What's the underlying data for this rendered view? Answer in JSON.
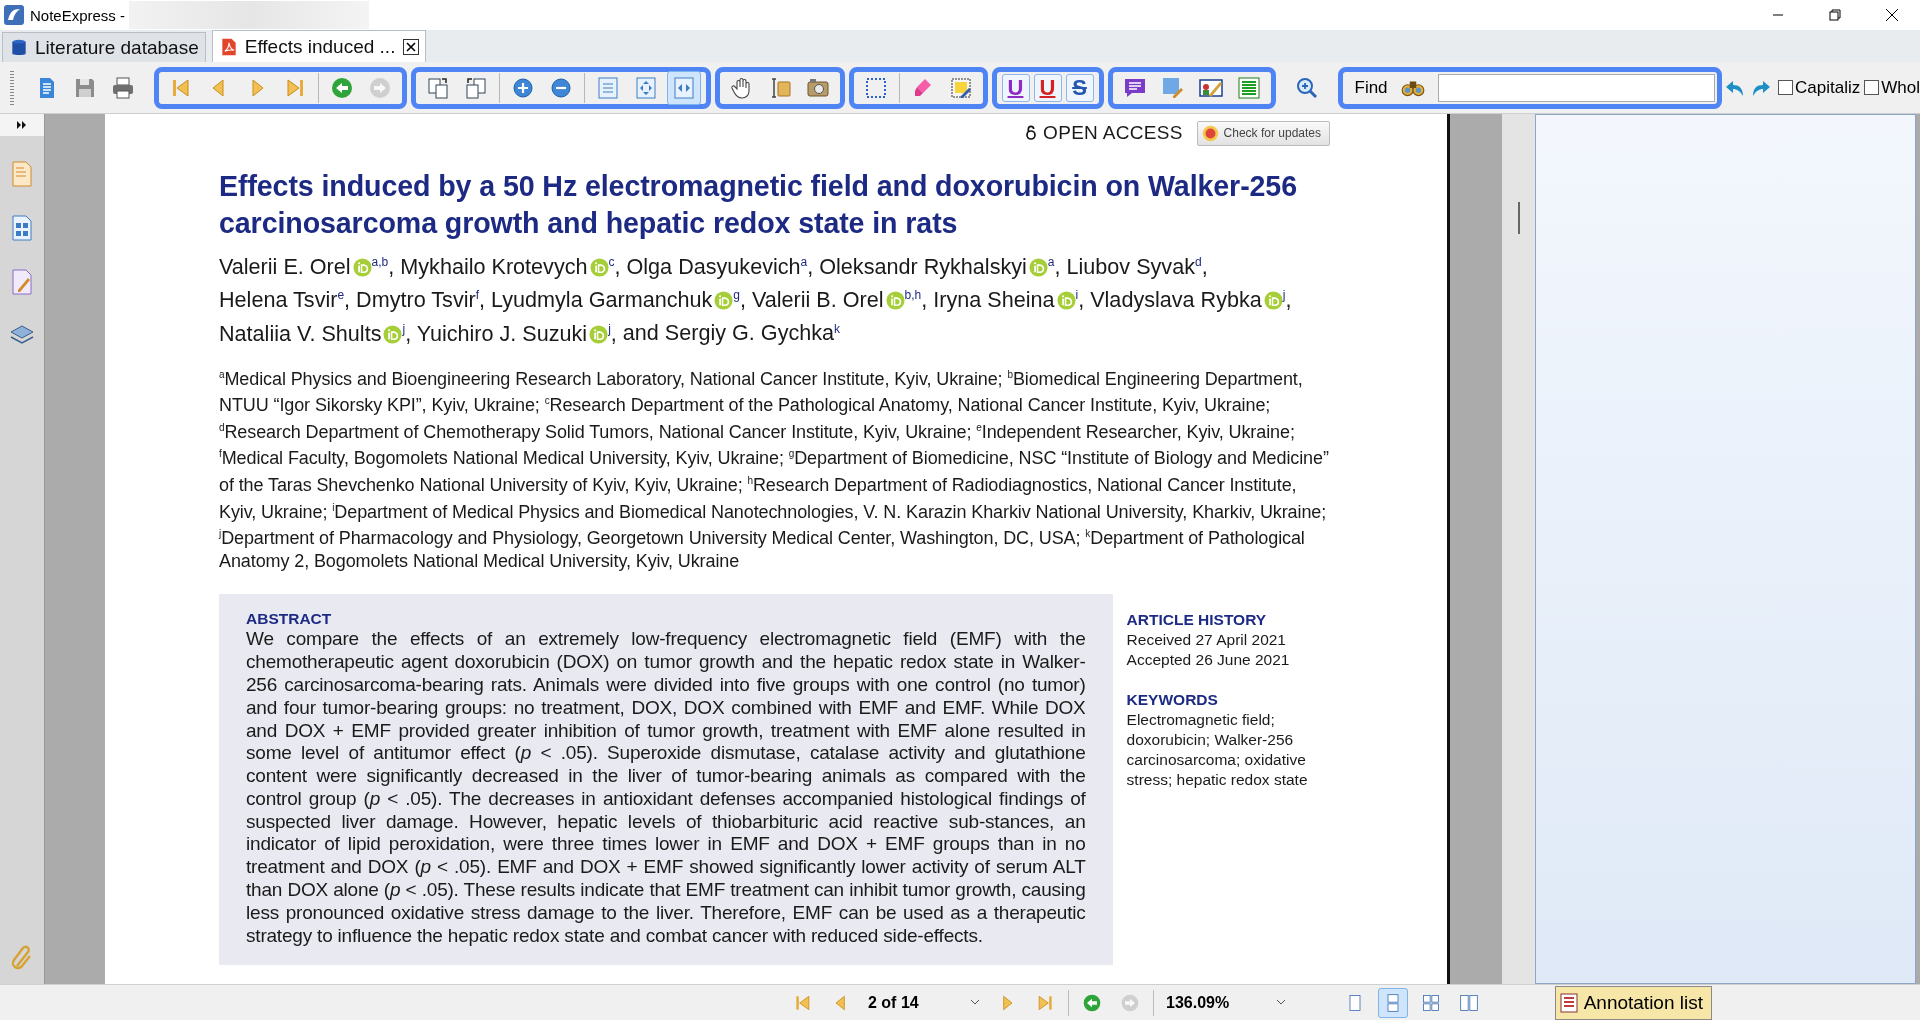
{
  "window": {
    "title": "NoteExpress -"
  },
  "tabs": [
    {
      "label": "Literature database",
      "selected": false,
      "closable": false
    },
    {
      "label": "Effects induced ...",
      "selected": true,
      "closable": true
    }
  ],
  "toolbar": {
    "groups": [
      {
        "outlined": false,
        "sections": [
          [
            {
              "disabled": false,
              "selected": false
            },
            {
              "disabled": false,
              "selected": false
            },
            {
              "disabled": false,
              "selected": false
            }
          ]
        ]
      },
      {
        "outlined": true,
        "sections": [
          [
            {
              "disabled": false,
              "selected": false
            },
            {
              "disabled": false,
              "selected": false
            },
            {
              "disabled": false,
              "selected": false
            },
            {
              "disabled": false,
              "selected": false
            }
          ],
          [
            {
              "disabled": false,
              "selected": false
            },
            {
              "disabled": true,
              "selected": false
            }
          ]
        ]
      },
      {
        "outlined": true,
        "sections": [
          [
            {
              "disabled": false,
              "selected": false
            },
            {
              "disabled": false,
              "selected": false
            }
          ],
          [
            {
              "disabled": false,
              "selected": false
            },
            {
              "disabled": false,
              "selected": false
            }
          ],
          [
            {
              "disabled": false,
              "selected": false
            },
            {
              "disabled": false,
              "selected": false
            },
            {
              "disabled": false,
              "selected": true
            }
          ]
        ]
      },
      {
        "outlined": true,
        "sections": [
          [
            {
              "disabled": false,
              "selected": false
            },
            {
              "disabled": false,
              "selected": false
            },
            {
              "disabled": false,
              "selected": false
            }
          ]
        ]
      },
      {
        "outlined": true,
        "sections": [
          [
            {
              "disabled": false,
              "selected": false
            }
          ],
          [
            {
              "disabled": false,
              "selected": false
            },
            {
              "disabled": false,
              "selected": false
            }
          ]
        ]
      },
      {
        "outlined": true,
        "sections": [
          [
            {
              "kind": "underline",
              "label": "U",
              "color": "#8e2bc4",
              "disabled": false,
              "selected": false
            },
            {
              "kind": "underline",
              "label": "U",
              "color": "#d42222",
              "disabled": false,
              "selected": false
            },
            {
              "kind": "strikeout",
              "label": "S",
              "color": "#2456b0",
              "disabled": false,
              "selected": false
            }
          ]
        ]
      },
      {
        "outlined": true,
        "sections": [
          [
            {
              "disabled": false,
              "selected": false
            },
            {
              "disabled": false,
              "selected": false
            },
            {
              "disabled": false,
              "selected": false
            },
            {
              "disabled": false,
              "selected": false
            }
          ]
        ]
      },
      {
        "outlined": false,
        "sections": [
          [
            {
              "disabled": false,
              "selected": false
            }
          ]
        ]
      }
    ]
  },
  "find": {
    "label": "Find",
    "outlined": true
  },
  "history": [
    {
      "disabled": false
    },
    {
      "disabled": false
    }
  ],
  "options": [
    {
      "label": "Capitaliz",
      "checked": false
    },
    {
      "label": "Whol",
      "checked": false
    }
  ],
  "document": {
    "open_access": "OPEN ACCESS",
    "update_button": "Check for updates",
    "title": "Effects induced by a 50 Hz electromagnetic field and doxorubicin on Walker-256 carcinosarcoma growth and hepatic redox state in rats",
    "authors": [
      {
        "name": "Valerii E. Orel",
        "orcid": true,
        "affiliation": "a,b",
        "separator": ","
      },
      {
        "name": "Mykhailo Krotevych",
        "orcid": true,
        "affiliation": "c",
        "separator": ","
      },
      {
        "name": "Olga Dasyukevich",
        "orcid": false,
        "affiliation": "a",
        "separator": ","
      },
      {
        "name": "Oleksandr Rykhalskyi",
        "orcid": true,
        "affiliation": "a",
        "separator": ","
      },
      {
        "name": "Liubov Syvak",
        "orcid": false,
        "affiliation": "d",
        "separator": ","
      },
      {
        "name": "Helena Tsvir",
        "orcid": false,
        "affiliation": "e",
        "separator": ","
      },
      {
        "name": "Dmytro Tsvir",
        "orcid": false,
        "affiliation": "f",
        "separator": ","
      },
      {
        "name": "Lyudmyla Garmanchuk",
        "orcid": true,
        "affiliation": "g",
        "separator": ","
      },
      {
        "name": "Valerii B. Orel",
        "orcid": true,
        "affiliation": "b,h",
        "separator": ","
      },
      {
        "name": "Iryna Sheina",
        "orcid": true,
        "affiliation": "i",
        "separator": ","
      },
      {
        "name": "Vladyslava Rybka",
        "orcid": true,
        "affiliation": "j",
        "separator": ","
      },
      {
        "name": "Nataliia V. Shults",
        "orcid": true,
        "affiliation": "j",
        "separator": ","
      },
      {
        "name": "Yuichiro J. Suzuki",
        "orcid": true,
        "affiliation": "j",
        "separator": ","
      },
      {
        "name": "and Sergiy G. Gychka",
        "orcid": false,
        "affiliation": "k"
      }
    ],
    "affiliations": "$^{a}$Medical Physics and Bioengineering Research Laboratory, National Cancer Institute, Kyiv, Ukraine; $^{b}$Biomedical Engineering Department, NTUU “Igor Sikorsky KPI”, Kyiv, Ukraine; $^{c}$Research Department of the Pathological Anatomy, National Cancer Institute, Kyiv, Ukraine; $^{d}$Research Department of Chemotherapy Solid Tumors, National Cancer Institute, Kyiv, Ukraine; $^{e}$Independent Researcher, Kyiv, Ukraine; $^{f}$Medical Faculty, Bogomolets National Medical University, Kyiv, Ukraine; $^{g}$Department of Biomedicine, NSC “Institute of Biology and Medicine” of the Taras Shevchenko National University of Kyiv, Kyiv, Ukraine; $^{h}$Research Department of Radiodiagnostics, National Cancer Institute, Kyiv, Ukraine; $^{i}$Department of Medical Physics and Biomedical Nanotechnologies, V. N. Karazin Kharkiv National University, Kharkiv, Ukraine; $^{j}$Department of Pharmacology and Physiology, Georgetown University Medical Center, Washington, DC, USA; $^{k}$Department of Pathological Anatomy 2, Bogomolets National Medical University, Kyiv, Ukraine",
    "abstract": {
      "heading": "ABSTRACT",
      "text": "We compare the effects of an extremely low-frequency electromagnetic field (EMF) with the chemotherapeutic agent doxorubicin (DOX) on tumor growth and the hepatic redox state in Walker-256 carcinosarcoma-bearing rats. Animals were divided into five groups with one control (no tumor) and four tumor-bearing groups: no treatment, DOX, DOX combined with EMF and EMF. While DOX and DOX + EMF provided greater inhibition of tumor growth, treatment with EMF alone resulted in some level of antitumor effect (*p* < .05). Superoxide dismutase, catalase activity and glutathione content were significantly decreased in the liver of tumor-bearing animals as compared with the control group (*p* < .05). The decreases in antioxidant defenses accompanied histological findings of suspected liver damage. However, hepatic levels of thiobarbituric acid reactive sub-stances, an indicator of lipid peroxidation, were three times lower in EMF and DOX + EMF groups than in no treatment and DOX (*p* < .05). EMF and DOX + EMF showed significantly lower activity of serum ALT than DOX alone (*p* < .05). These results indicate that EMF treatment can inhibit tumor growth, causing less pronounced oxidative stress damage to the liver. Therefore, EMF can be used as a therapeutic strategy to influence the hepatic redox state and combat cancer with reduced side-effects."
    },
    "article_history": {
      "heading": "ARTICLE HISTORY",
      "lines": [
        "Received 27 April 2021",
        "Accepted 26 June 2021"
      ]
    },
    "keywords": {
      "heading": "KEYWORDS",
      "text": "Electromagnetic field; doxorubicin; Walker-256 carcinosarcoma; oxidative stress; hepatic redox state"
    }
  },
  "statusbar": {
    "page_nav": [
      {
        "disabled": false
      },
      {
        "disabled": false
      },
      {
        "disabled": false
      },
      {
        "disabled": false
      }
    ],
    "page": "2 of 14",
    "history": [
      {
        "disabled": false
      },
      {
        "disabled": true
      }
    ],
    "zoom": "136.09%",
    "views": [
      {
        "selected": false
      },
      {
        "selected": true
      },
      {
        "selected": false
      },
      {
        "selected": false
      }
    ]
  },
  "annotation_tab": {
    "label": "Annotation list"
  }
}
